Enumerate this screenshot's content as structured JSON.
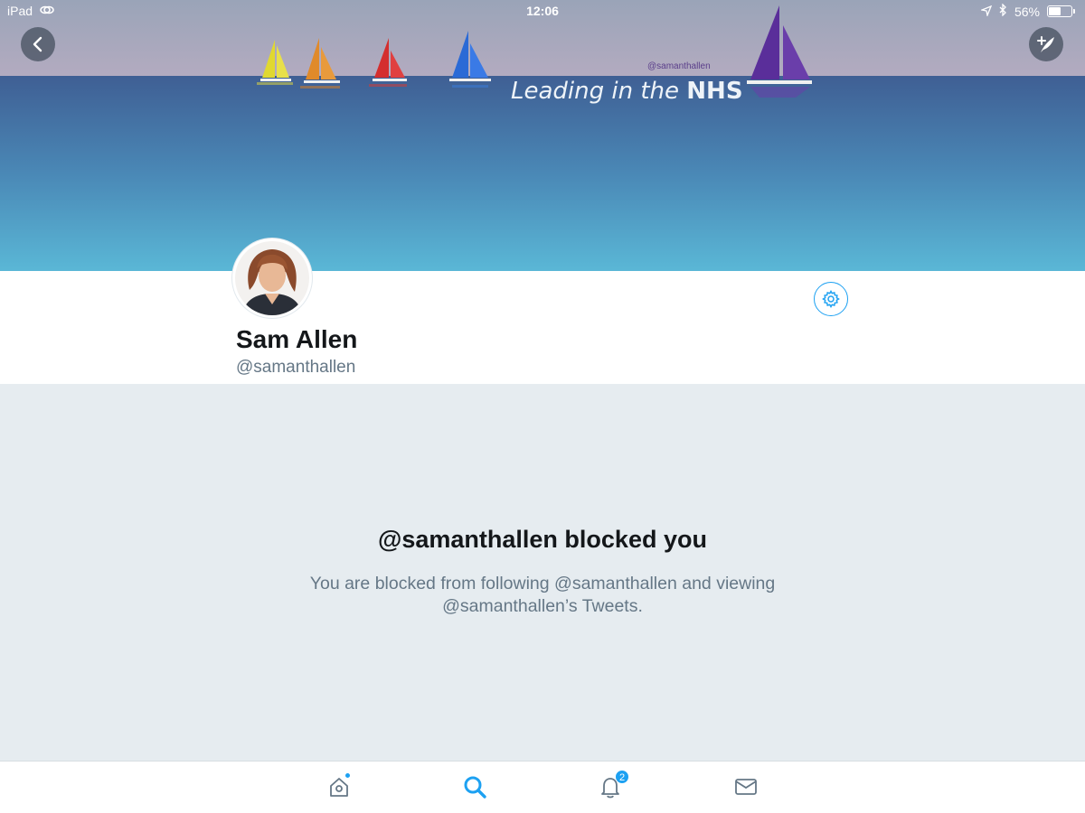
{
  "status_bar": {
    "device": "iPad",
    "time": "12:06",
    "battery_percent_label": "56%",
    "battery_level": 0.56
  },
  "banner": {
    "handle_text": "@samanthallen",
    "tagline_italic": "Leading in the",
    "tagline_bold": "NHS",
    "colors": {
      "sky_top": "#9aa4b8",
      "sky_bottom": "#b3abc0",
      "sea_top": "#3f5f94",
      "sea_bottom": "#5ab7d6"
    },
    "sail_colors": [
      "#e0d830",
      "#e08a2a",
      "#d42e2e",
      "#2a6ad6",
      "#5a2e9a"
    ]
  },
  "profile": {
    "display_name": "Sam Allen",
    "handle": "@samanthallen"
  },
  "blocked": {
    "title": "@samanthallen blocked you",
    "line1": "You are blocked from following @samanthallen and viewing",
    "line2": "@samanthallen’s Tweets."
  },
  "tab_bar": {
    "tabs": [
      {
        "name": "home",
        "icon": "home-icon",
        "has_dot": true
      },
      {
        "name": "search",
        "icon": "search-icon",
        "active": true
      },
      {
        "name": "notifications",
        "icon": "bell-icon",
        "badge": "2"
      },
      {
        "name": "messages",
        "icon": "envelope-icon"
      }
    ],
    "accent": "#1da1f2",
    "inactive": "#657786"
  }
}
